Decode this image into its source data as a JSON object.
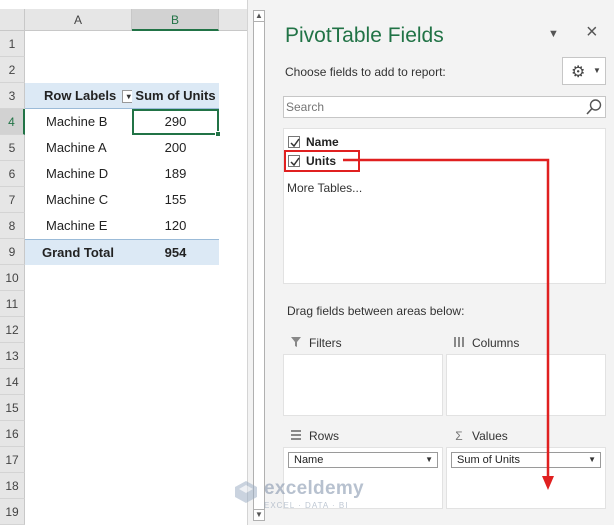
{
  "sheet": {
    "columns": [
      "A",
      "B"
    ],
    "row_numbers": [
      "1",
      "2",
      "3",
      "4",
      "5",
      "6",
      "7",
      "8",
      "9",
      "10",
      "11",
      "12",
      "13",
      "14",
      "15",
      "16",
      "17",
      "18",
      "19"
    ],
    "pivot": {
      "header_row_labels": "Row Labels",
      "header_sum_units": "Sum of Units",
      "rows": [
        {
          "label": "Machine B",
          "value": "290"
        },
        {
          "label": "Machine A",
          "value": "200"
        },
        {
          "label": "Machine D",
          "value": "189"
        },
        {
          "label": "Machine C",
          "value": "155"
        },
        {
          "label": "Machine E",
          "value": "120"
        }
      ],
      "grand_total_label": "Grand Total",
      "grand_total_value": "954"
    },
    "active_cell": "B4"
  },
  "pane": {
    "title": "PivotTable Fields",
    "choose_label": "Choose fields to add to report:",
    "search_placeholder": "Search",
    "fields": [
      {
        "name": "Name",
        "checked": true
      },
      {
        "name": "Units",
        "checked": true,
        "highlighted": true
      }
    ],
    "more_tables": "More Tables...",
    "drag_label": "Drag fields between areas below:",
    "areas": {
      "filters": {
        "label": "Filters",
        "items": []
      },
      "columns": {
        "label": "Columns",
        "items": []
      },
      "rows": {
        "label": "Rows",
        "items": [
          "Name"
        ]
      },
      "values": {
        "label": "Values",
        "items": [
          "Sum of Units"
        ]
      }
    }
  },
  "annotation": {
    "color": "#e02020",
    "description_icon": "arrow-down-icon"
  },
  "watermark": {
    "name": "exceldemy",
    "tagline": "EXCEL · DATA · BI"
  },
  "colors": {
    "excel_green": "#217346",
    "pivot_header_blue": "#dce9f5"
  }
}
